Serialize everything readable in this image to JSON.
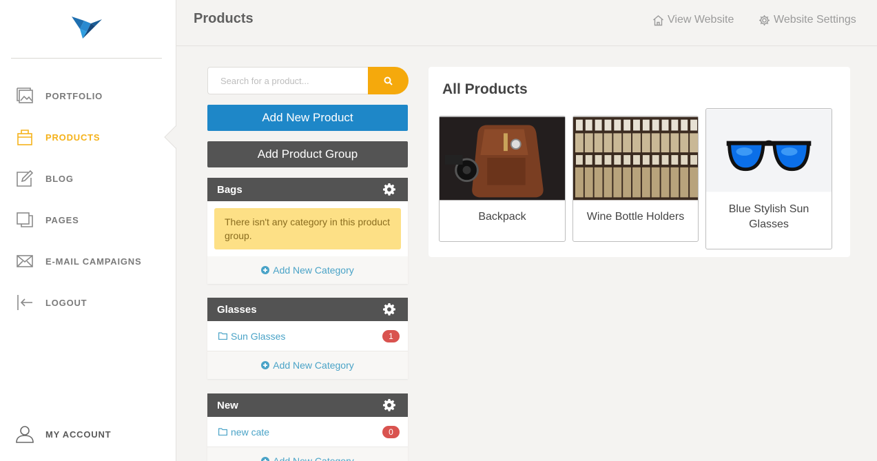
{
  "sidebar": {
    "items": [
      {
        "label": "PORTFOLIO",
        "icon": "image-gallery-icon"
      },
      {
        "label": "PRODUCTS",
        "icon": "box-icon",
        "active": true
      },
      {
        "label": "BLOG",
        "icon": "edit-icon"
      },
      {
        "label": "PAGES",
        "icon": "pages-icon"
      },
      {
        "label": "E-MAIL CAMPAIGNS",
        "icon": "envelope-icon"
      },
      {
        "label": "LOGOUT",
        "icon": "logout-icon"
      }
    ],
    "account_label": "MY ACCOUNT"
  },
  "header": {
    "title": "Products",
    "view_website": "View Website",
    "website_settings": "Website Settings"
  },
  "search": {
    "placeholder": "Search for a product..."
  },
  "buttons": {
    "add_product": "Add New Product",
    "add_group": "Add Product Group"
  },
  "groups": [
    {
      "name": "Bags",
      "empty_message": "There isn't any category in this product group.",
      "categories": [],
      "add_category": "Add New Category"
    },
    {
      "name": "Glasses",
      "categories": [
        {
          "name": "Sun Glasses",
          "count": "1"
        }
      ],
      "add_category": "Add New Category"
    },
    {
      "name": "New",
      "categories": [
        {
          "name": "new cate",
          "count": "0"
        }
      ],
      "add_category": "Add New Category"
    }
  ],
  "products_panel": {
    "title": "All Products",
    "products": [
      {
        "name": "Backpack"
      },
      {
        "name": "Wine Bottle Holders"
      },
      {
        "name": "Blue Stylish Sun Glasses"
      }
    ]
  },
  "colors": {
    "accent": "#f5b21a",
    "primary_button": "#1e87c8",
    "dark_button": "#545454",
    "badge": "#d9534f",
    "link": "#4aa3c7"
  }
}
